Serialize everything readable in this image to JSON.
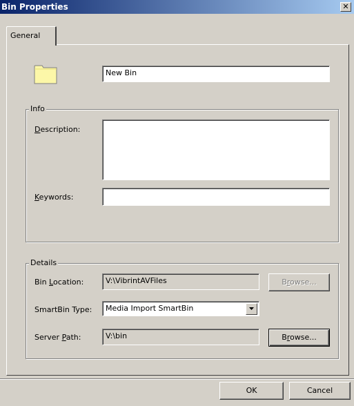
{
  "window": {
    "title": "Bin Properties",
    "close_glyph": "✕"
  },
  "tabs": [
    {
      "label": "General",
      "active": true
    }
  ],
  "general": {
    "bin_name_value": "New Bin",
    "folder_icon": "folder-icon",
    "folder_color": "#fcf7a8"
  },
  "info": {
    "group_title": "Info",
    "description_label_key": "D",
    "description_label_rest": "escription:",
    "description_value": "",
    "keywords_label_key": "K",
    "keywords_label_rest": "eywords:",
    "keywords_value": ""
  },
  "details": {
    "group_title": "Details",
    "bin_location_label_pre": "Bin ",
    "bin_location_label_key": "L",
    "bin_location_label_rest": "ocation:",
    "bin_location_value": "V:\\VibrintAVFiles",
    "browse1_pre": "B",
    "browse1_key": "r",
    "browse1_rest": "owse...",
    "browse1_enabled": false,
    "smartbin_type_label": "SmartBin Type:",
    "smartbin_type_value": "Media Import SmartBin",
    "server_path_label_pre": "Server ",
    "server_path_label_key": "P",
    "server_path_label_rest": "ath:",
    "server_path_value": "V:\\bin",
    "browse2_pre": "B",
    "browse2_key": "r",
    "browse2_rest": "owse...",
    "browse2_enabled": true
  },
  "footer": {
    "ok_label": "OK",
    "cancel_label": "Cancel"
  }
}
